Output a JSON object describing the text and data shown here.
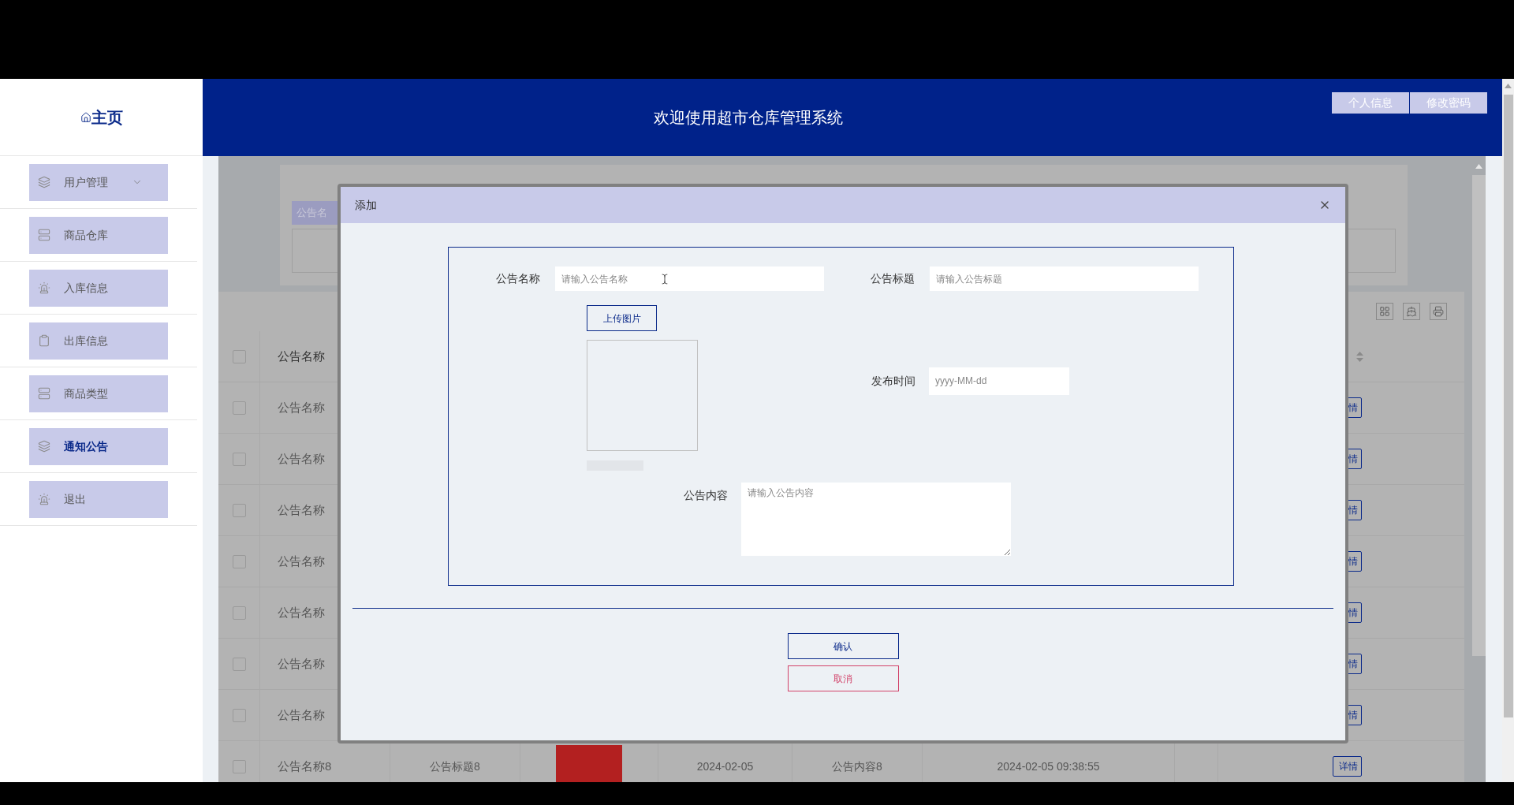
{
  "sidebar": {
    "logo": "主页",
    "items": [
      {
        "label": "用户管理",
        "selected": false,
        "kind": "dropdown"
      },
      {
        "label": "商品仓库",
        "selected": false,
        "kind": "link"
      },
      {
        "label": "入库信息",
        "selected": false,
        "kind": "link"
      },
      {
        "label": "出库信息",
        "selected": false,
        "kind": "link"
      },
      {
        "label": "商品类型",
        "selected": false,
        "kind": "link"
      },
      {
        "label": "通知公告",
        "selected": true,
        "kind": "link"
      },
      {
        "label": "退出",
        "selected": false,
        "kind": "link"
      }
    ]
  },
  "header": {
    "title": "欢迎使用超市仓库管理系统",
    "buttons": [
      "个人信息",
      "修改密码"
    ]
  },
  "search": {
    "label": "公告名"
  },
  "table": {
    "header": {
      "checked": false,
      "column_1": "公告名称"
    },
    "rows": [
      {
        "checked": false,
        "name": "公告名称",
        "action": "情"
      },
      {
        "checked": false,
        "name": "公告名称",
        "action": "情"
      },
      {
        "checked": false,
        "name": "公告名称",
        "action": "情"
      },
      {
        "checked": false,
        "name": "公告名称",
        "action": "情"
      },
      {
        "checked": false,
        "name": "公告名称",
        "action": "情"
      },
      {
        "checked": false,
        "name": "公告名称",
        "action": "情"
      },
      {
        "checked": false,
        "name": "公告名称",
        "action": "情"
      },
      {
        "checked": false,
        "name": "公告名称8",
        "title": "公告标题8",
        "image": true,
        "date": "2024-02-05",
        "content": "公告内容8",
        "time": "2024-02-05 09:38:55",
        "action": "详情"
      }
    ]
  },
  "modal": {
    "title": "添加",
    "fields": [
      {
        "label": "公告名称",
        "placeholder": "请输入公告名称"
      },
      {
        "label": "公告标题",
        "placeholder": "请输入公告标题"
      }
    ],
    "upload_button": "上传图片",
    "date_field": {
      "label": "发布时间",
      "placeholder": "yyyy-MM-dd"
    },
    "content_field": {
      "label": "公告内容",
      "placeholder": "请输入公告内容"
    },
    "buttons": [
      {
        "label": "确认",
        "kind": "primary"
      },
      {
        "label": "取消",
        "kind": "danger"
      }
    ]
  }
}
